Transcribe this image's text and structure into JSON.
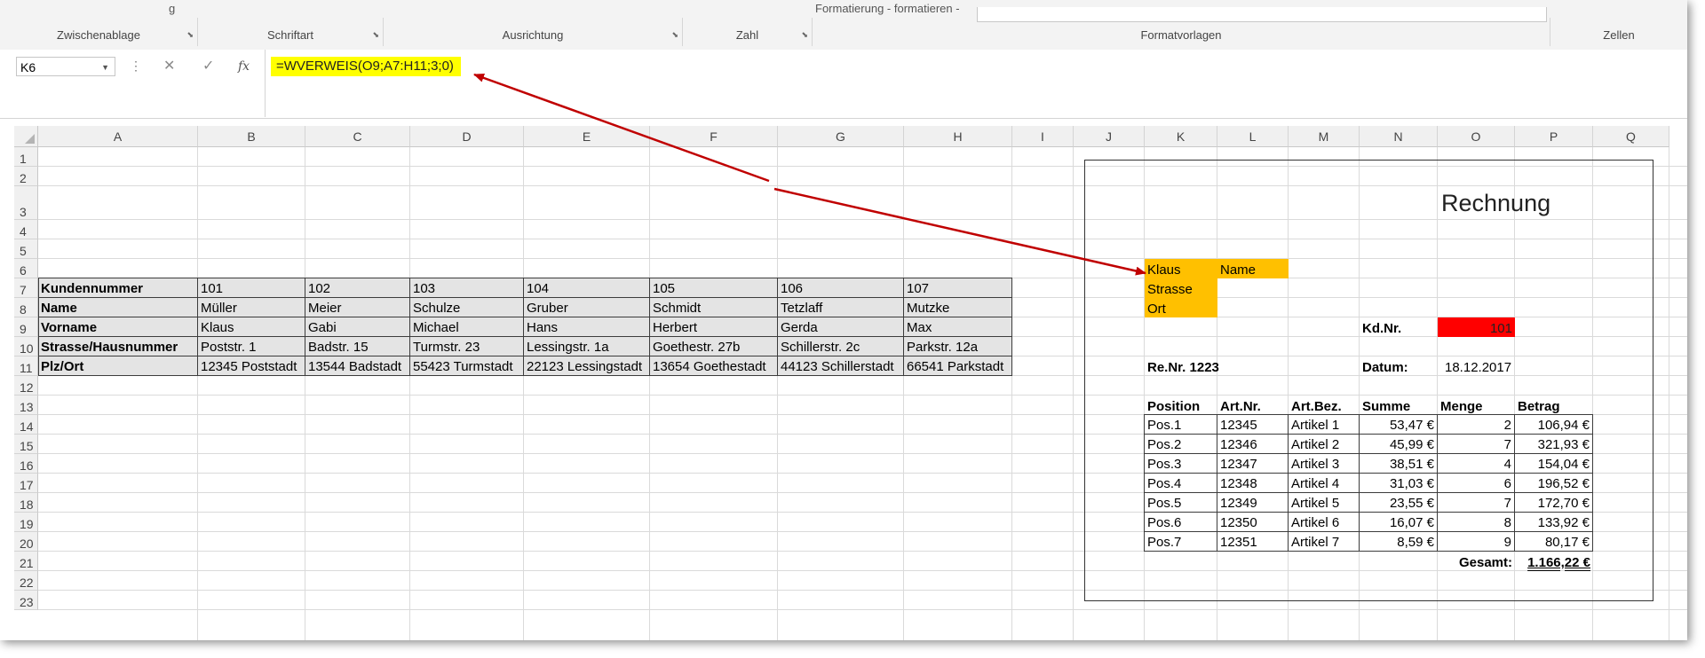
{
  "ribbon": {
    "cut_text_left": "g",
    "cut_text_formatting": "Formatierung - formatieren -",
    "groups": [
      {
        "label": "Zwischenablage"
      },
      {
        "label": "Schriftart"
      },
      {
        "label": "Ausrichtung"
      },
      {
        "label": "Zahl"
      },
      {
        "label": "Formatvorlagen"
      },
      {
        "label": "Zellen"
      }
    ]
  },
  "formula_bar": {
    "name_box": "K6",
    "cancel_icon": "✕",
    "enter_icon": "✓",
    "fx_icon": "fx",
    "formula": "=WVERWEIS(O9;A7:H11;3;0)"
  },
  "columns": [
    "A",
    "B",
    "C",
    "D",
    "E",
    "F",
    "G",
    "H",
    "I",
    "J",
    "K",
    "L",
    "M",
    "N",
    "O",
    "P",
    "Q"
  ],
  "rows": [
    "1",
    "2",
    "3",
    "4",
    "5",
    "6",
    "7",
    "8",
    "9",
    "10",
    "11",
    "12",
    "13",
    "14",
    "15",
    "16",
    "17",
    "18",
    "19",
    "20",
    "21",
    "22",
    "23"
  ],
  "customer_table": {
    "rows": [
      [
        "Kundennummer",
        "101",
        "102",
        "103",
        "104",
        "105",
        "106",
        "107"
      ],
      [
        "Name",
        "Müller",
        "Meier",
        "Schulze",
        "Gruber",
        "Schmidt",
        "Tetzlaff",
        "Mutzke"
      ],
      [
        "Vorname",
        "Klaus",
        "Gabi",
        "Michael",
        "Hans",
        "Herbert",
        "Gerda",
        "Max"
      ],
      [
        "Strasse/Hausnummer",
        "Poststr. 1",
        "Badstr. 15",
        "Turmstr. 23",
        "Lessingstr. 1a",
        "Goethestr. 27b",
        "Schillerstr. 2c",
        "Parkstr. 12a"
      ],
      [
        "Plz/Ort",
        "12345 Poststadt",
        "13544 Badstadt",
        "55423 Turmstadt",
        "22123 Lessingstadt",
        "13654 Goethestadt",
        "44123 Schillerstadt",
        "66541 Parkstadt"
      ]
    ]
  },
  "invoice": {
    "title": "Rechnung",
    "address": [
      {
        "value": "Klaus",
        "label": "Name"
      },
      {
        "value": "Strasse",
        "label": ""
      },
      {
        "value": "Ort",
        "label": ""
      }
    ],
    "kdnr_label": "Kd.Nr.",
    "kdnr_value": "101",
    "renr": "Re.Nr. 1223",
    "datum_label": "Datum:",
    "datum_value": "18.12.2017",
    "headers": [
      "Position",
      "Art.Nr.",
      "Art.Bez.",
      "Summe",
      "Menge",
      "Betrag"
    ],
    "items": [
      [
        "Pos.1",
        "12345",
        "Artikel 1",
        "53,47 €",
        "2",
        "106,94 €"
      ],
      [
        "Pos.2",
        "12346",
        "Artikel 2",
        "45,99 €",
        "7",
        "321,93 €"
      ],
      [
        "Pos.3",
        "12347",
        "Artikel 3",
        "38,51 €",
        "4",
        "154,04 €"
      ],
      [
        "Pos.4",
        "12348",
        "Artikel 4",
        "31,03 €",
        "6",
        "196,52 €"
      ],
      [
        "Pos.5",
        "12349",
        "Artikel 5",
        "23,55 €",
        "7",
        "172,70 €"
      ],
      [
        "Pos.6",
        "12350",
        "Artikel 6",
        "16,07 €",
        "8",
        "133,92 €"
      ],
      [
        "Pos.7",
        "12351",
        "Artikel 7",
        "8,59 €",
        "9",
        "80,17 €"
      ]
    ],
    "total_label": "Gesamt:",
    "total_value": "1.166,22 €"
  },
  "colors": {
    "formula_highlight": "#ffff00",
    "address_highlight": "#ffc000",
    "kdnr_highlight": "#ff0000",
    "arrow": "#c00000"
  }
}
